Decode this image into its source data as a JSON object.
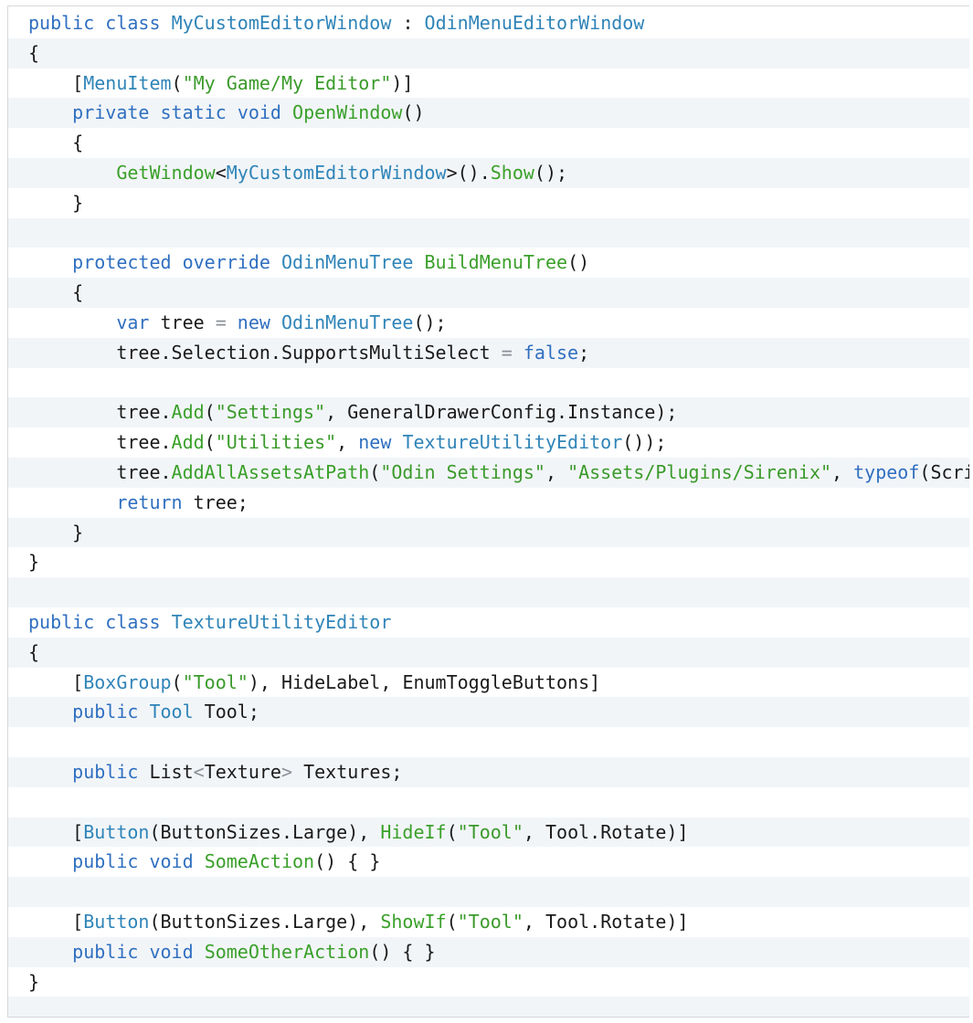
{
  "colors": {
    "keyword": "#2f6fc0",
    "type": "#2f84b8",
    "method": "#3aa02a",
    "string": "#3a9a2a",
    "plain": "#1a1a1a",
    "operator": "#8a9096",
    "stripe": "#f2f5f8"
  },
  "code": {
    "lines": [
      [
        [
          "kw",
          "public"
        ],
        [
          "plain",
          " "
        ],
        [
          "kw",
          "class"
        ],
        [
          "plain",
          " "
        ],
        [
          "type",
          "MyCustomEditorWindow"
        ],
        [
          "plain",
          " "
        ],
        [
          "punct",
          ":"
        ],
        [
          "plain",
          " "
        ],
        [
          "type",
          "OdinMenuEditorWindow"
        ]
      ],
      [
        [
          "punct",
          "{"
        ]
      ],
      [
        [
          "plain",
          "    "
        ],
        [
          "punct",
          "["
        ],
        [
          "type",
          "MenuItem"
        ],
        [
          "punct",
          "("
        ],
        [
          "str",
          "\"My Game/My Editor\""
        ],
        [
          "punct",
          ")]"
        ]
      ],
      [
        [
          "plain",
          "    "
        ],
        [
          "kw",
          "private"
        ],
        [
          "plain",
          " "
        ],
        [
          "kw",
          "static"
        ],
        [
          "plain",
          " "
        ],
        [
          "kw",
          "void"
        ],
        [
          "plain",
          " "
        ],
        [
          "method",
          "OpenWindow"
        ],
        [
          "punct",
          "()"
        ]
      ],
      [
        [
          "plain",
          "    "
        ],
        [
          "punct",
          "{"
        ]
      ],
      [
        [
          "plain",
          "        "
        ],
        [
          "method",
          "GetWindow"
        ],
        [
          "punct",
          "<"
        ],
        [
          "type",
          "MyCustomEditorWindow"
        ],
        [
          "punct",
          ">()."
        ],
        [
          "method",
          "Show"
        ],
        [
          "punct",
          "();"
        ]
      ],
      [
        [
          "plain",
          "    "
        ],
        [
          "punct",
          "}"
        ]
      ],
      [],
      [
        [
          "plain",
          "    "
        ],
        [
          "kw",
          "protected"
        ],
        [
          "plain",
          " "
        ],
        [
          "kw",
          "override"
        ],
        [
          "plain",
          " "
        ],
        [
          "type",
          "OdinMenuTree"
        ],
        [
          "plain",
          " "
        ],
        [
          "method",
          "BuildMenuTree"
        ],
        [
          "punct",
          "()"
        ]
      ],
      [
        [
          "plain",
          "    "
        ],
        [
          "punct",
          "{"
        ]
      ],
      [
        [
          "plain",
          "        "
        ],
        [
          "kw",
          "var"
        ],
        [
          "plain",
          " tree "
        ],
        [
          "op",
          "="
        ],
        [
          "plain",
          " "
        ],
        [
          "kw",
          "new"
        ],
        [
          "plain",
          " "
        ],
        [
          "type",
          "OdinMenuTree"
        ],
        [
          "punct",
          "();"
        ]
      ],
      [
        [
          "plain",
          "        tree.Selection.SupportsMultiSelect "
        ],
        [
          "op",
          "="
        ],
        [
          "plain",
          " "
        ],
        [
          "kw",
          "false"
        ],
        [
          "punct",
          ";"
        ]
      ],
      [],
      [
        [
          "plain",
          "        tree."
        ],
        [
          "method",
          "Add"
        ],
        [
          "punct",
          "("
        ],
        [
          "str",
          "\"Settings\""
        ],
        [
          "punct",
          ", "
        ],
        [
          "plain",
          "GeneralDrawerConfig.Instance"
        ],
        [
          "punct",
          ");"
        ]
      ],
      [
        [
          "plain",
          "        tree."
        ],
        [
          "method",
          "Add"
        ],
        [
          "punct",
          "("
        ],
        [
          "str",
          "\"Utilities\""
        ],
        [
          "punct",
          ", "
        ],
        [
          "kw",
          "new"
        ],
        [
          "plain",
          " "
        ],
        [
          "type",
          "TextureUtilityEditor"
        ],
        [
          "punct",
          "());"
        ]
      ],
      [
        [
          "plain",
          "        tree."
        ],
        [
          "method",
          "AddAllAssetsAtPath"
        ],
        [
          "punct",
          "("
        ],
        [
          "str",
          "\"Odin Settings\""
        ],
        [
          "punct",
          ", "
        ],
        [
          "str",
          "\"Assets/Plugins/Sirenix\""
        ],
        [
          "punct",
          ", "
        ],
        [
          "kw",
          "typeof"
        ],
        [
          "punct",
          "("
        ],
        [
          "plain",
          "Scri"
        ]
      ],
      [
        [
          "plain",
          "        "
        ],
        [
          "kw",
          "return"
        ],
        [
          "plain",
          " tree"
        ],
        [
          "punct",
          ";"
        ]
      ],
      [
        [
          "plain",
          "    "
        ],
        [
          "punct",
          "}"
        ]
      ],
      [
        [
          "punct",
          "}"
        ]
      ],
      [],
      [
        [
          "kw",
          "public"
        ],
        [
          "plain",
          " "
        ],
        [
          "kw",
          "class"
        ],
        [
          "plain",
          " "
        ],
        [
          "type",
          "TextureUtilityEditor"
        ]
      ],
      [
        [
          "punct",
          "{"
        ]
      ],
      [
        [
          "plain",
          "    "
        ],
        [
          "punct",
          "["
        ],
        [
          "type",
          "BoxGroup"
        ],
        [
          "punct",
          "("
        ],
        [
          "str",
          "\"Tool\""
        ],
        [
          "punct",
          "), "
        ],
        [
          "plain",
          "HideLabel"
        ],
        [
          "punct",
          ", "
        ],
        [
          "plain",
          "EnumToggleButtons"
        ],
        [
          "punct",
          "]"
        ]
      ],
      [
        [
          "plain",
          "    "
        ],
        [
          "kw",
          "public"
        ],
        [
          "plain",
          " "
        ],
        [
          "type",
          "Tool"
        ],
        [
          "plain",
          " Tool"
        ],
        [
          "punct",
          ";"
        ]
      ],
      [],
      [
        [
          "plain",
          "    "
        ],
        [
          "kw",
          "public"
        ],
        [
          "plain",
          " List"
        ],
        [
          "op",
          "<"
        ],
        [
          "plain",
          "Texture"
        ],
        [
          "op",
          ">"
        ],
        [
          "plain",
          " Textures"
        ],
        [
          "punct",
          ";"
        ]
      ],
      [],
      [
        [
          "plain",
          "    "
        ],
        [
          "punct",
          "["
        ],
        [
          "type",
          "Button"
        ],
        [
          "punct",
          "("
        ],
        [
          "plain",
          "ButtonSizes.Large"
        ],
        [
          "punct",
          "), "
        ],
        [
          "method",
          "HideIf"
        ],
        [
          "punct",
          "("
        ],
        [
          "str",
          "\"Tool\""
        ],
        [
          "punct",
          ", "
        ],
        [
          "plain",
          "Tool.Rotate"
        ],
        [
          "punct",
          ")]"
        ]
      ],
      [
        [
          "plain",
          "    "
        ],
        [
          "kw",
          "public"
        ],
        [
          "plain",
          " "
        ],
        [
          "kw",
          "void"
        ],
        [
          "plain",
          " "
        ],
        [
          "method",
          "SomeAction"
        ],
        [
          "punct",
          "() { }"
        ]
      ],
      [],
      [
        [
          "plain",
          "    "
        ],
        [
          "punct",
          "["
        ],
        [
          "type",
          "Button"
        ],
        [
          "punct",
          "("
        ],
        [
          "plain",
          "ButtonSizes.Large"
        ],
        [
          "punct",
          "), "
        ],
        [
          "method",
          "ShowIf"
        ],
        [
          "punct",
          "("
        ],
        [
          "str",
          "\"Tool\""
        ],
        [
          "punct",
          ", "
        ],
        [
          "plain",
          "Tool.Rotate"
        ],
        [
          "punct",
          ")]"
        ]
      ],
      [
        [
          "plain",
          "    "
        ],
        [
          "kw",
          "public"
        ],
        [
          "plain",
          " "
        ],
        [
          "kw",
          "void"
        ],
        [
          "plain",
          " "
        ],
        [
          "method",
          "SomeOtherAction"
        ],
        [
          "punct",
          "() { }"
        ]
      ],
      [
        [
          "punct",
          "}"
        ]
      ],
      []
    ]
  }
}
